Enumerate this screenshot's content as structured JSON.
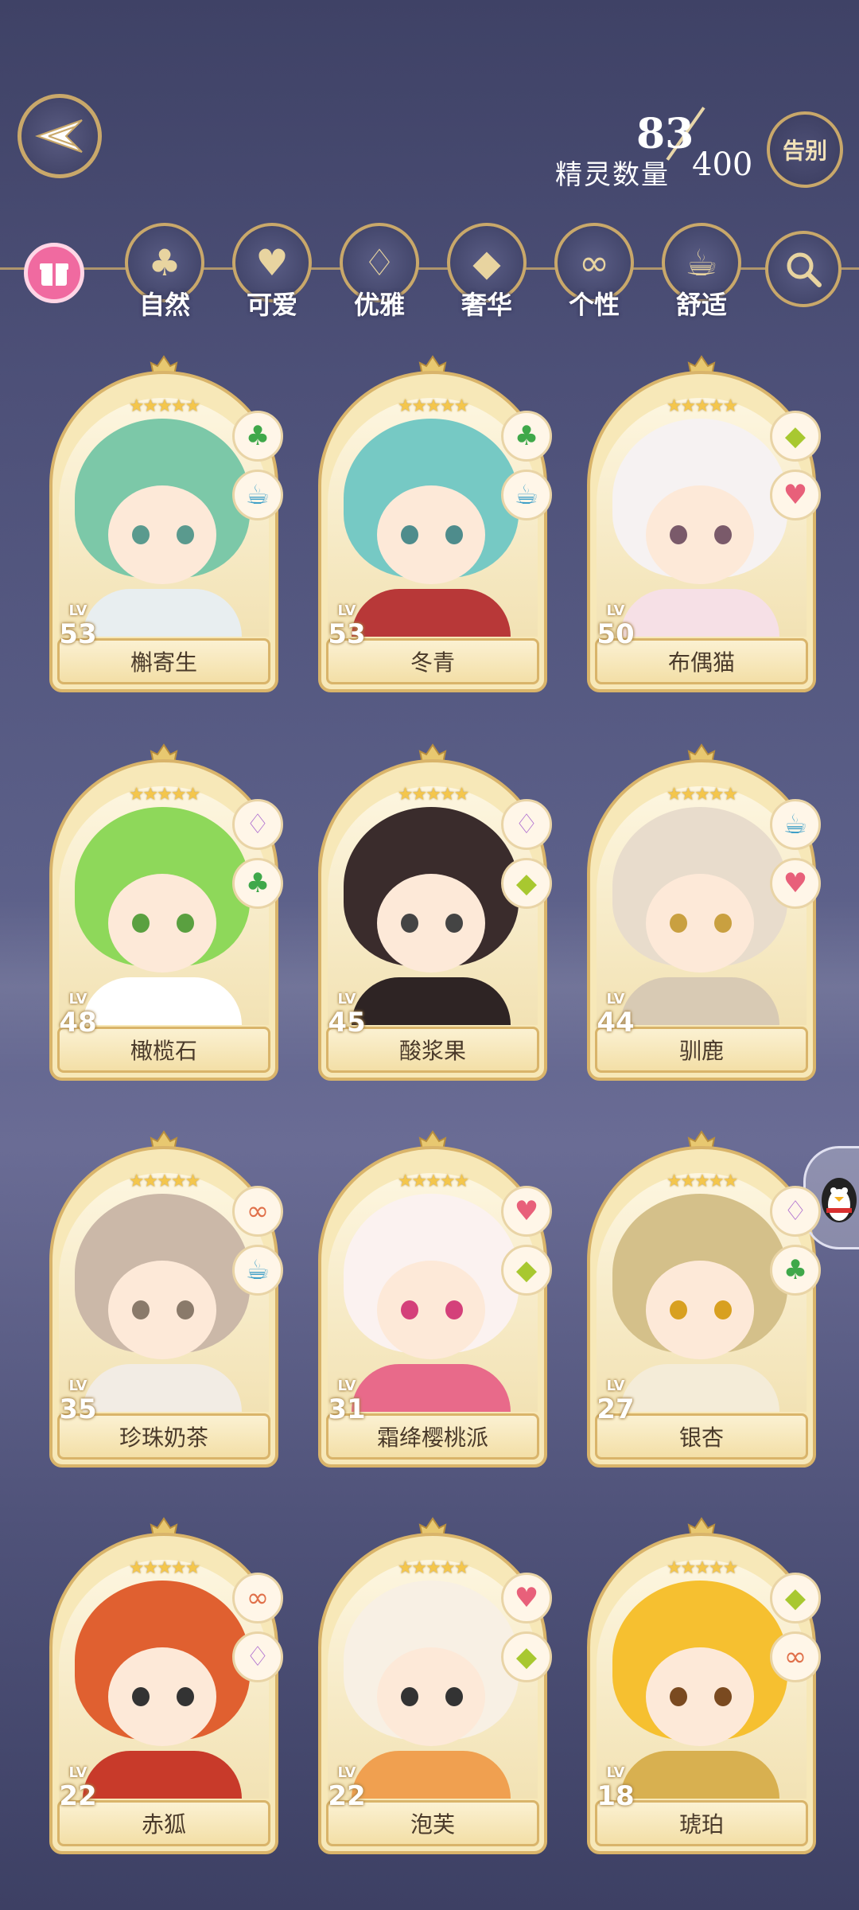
{
  "header": {
    "spirit_count": "83",
    "spirit_label": "精灵数量",
    "spirit_max": "400",
    "farewell_label": "告别"
  },
  "filters": [
    {
      "label": "自然",
      "icon": "clover-icon",
      "glyph": "♣"
    },
    {
      "label": "可爱",
      "icon": "heart-icon",
      "glyph": "♥"
    },
    {
      "label": "优雅",
      "icon": "swan-icon",
      "glyph": "♢"
    },
    {
      "label": "奢华",
      "icon": "diamond-icon",
      "glyph": "◆"
    },
    {
      "label": "个性",
      "icon": "glasses-icon",
      "glyph": "∞"
    },
    {
      "label": "舒适",
      "icon": "teacup-icon",
      "glyph": "☕"
    }
  ],
  "cards": [
    {
      "name": "槲寄生",
      "level": "53",
      "stars": "★★★★★",
      "tags": [
        "clover-icon",
        "teacup-icon"
      ],
      "hair": "#7cc8a8",
      "body": "#e8eef0",
      "eye": "#5a9a8e"
    },
    {
      "name": "冬青",
      "level": "53",
      "stars": "★★★★★",
      "tags": [
        "clover-icon",
        "teacup-icon"
      ],
      "hair": "#76c9c4",
      "body": "#b83838",
      "eye": "#4e8c8c"
    },
    {
      "name": "布偶猫",
      "level": "50",
      "stars": "★★★★★",
      "tags": [
        "diamond-icon",
        "heart-icon"
      ],
      "hair": "#f6f2f2",
      "body": "#f6e0e6",
      "eye": "#7a5a6a"
    },
    {
      "name": "橄榄石",
      "level": "48",
      "stars": "★★★★★",
      "tags": [
        "swan-icon",
        "clover-icon"
      ],
      "hair": "#8ed85a",
      "body": "#ffffff",
      "eye": "#5aa040"
    },
    {
      "name": "酸浆果",
      "level": "45",
      "stars": "★★★★★",
      "tags": [
        "swan-icon",
        "diamond-icon"
      ],
      "hair": "#3a2c2c",
      "body": "#2e2424",
      "eye": "#444444"
    },
    {
      "name": "驯鹿",
      "level": "44",
      "stars": "★★★★★",
      "tags": [
        "teacup-icon",
        "heart-icon"
      ],
      "hair": "#e8dccc",
      "body": "#d8cab4",
      "eye": "#c9a040"
    },
    {
      "name": "珍珠奶茶",
      "level": "35",
      "stars": "★★★★★",
      "tags": [
        "glasses-icon",
        "teacup-icon"
      ],
      "hair": "#cbb8a8",
      "body": "#f2ece4",
      "eye": "#8a7a6a"
    },
    {
      "name": "霜绛樱桃派",
      "level": "31",
      "stars": "★★★★★",
      "tags": [
        "heart-icon",
        "diamond-icon"
      ],
      "hair": "#fbf2f0",
      "body": "#e86a8a",
      "eye": "#d4407a"
    },
    {
      "name": "银杏",
      "level": "27",
      "stars": "★★★★★",
      "tags": [
        "swan-icon",
        "clover-icon"
      ],
      "hair": "#d4c08a",
      "body": "#f4ecd8",
      "eye": "#d8a020"
    },
    {
      "name": "赤狐",
      "level": "22",
      "stars": "★★★★★",
      "tags": [
        "glasses-icon",
        "swan-icon"
      ],
      "hair": "#e06030",
      "body": "#c83a2a",
      "eye": "#333333"
    },
    {
      "name": "泡芙",
      "level": "22",
      "stars": "★★★★★",
      "tags": [
        "heart-icon",
        "diamond-icon"
      ],
      "hair": "#f8f0e4",
      "body": "#f0a050",
      "eye": "#333333"
    },
    {
      "name": "琥珀",
      "level": "18",
      "stars": "★★★★★",
      "tags": [
        "diamond-icon",
        "glasses-icon"
      ],
      "hair": "#f6c030",
      "body": "#d8b050",
      "eye": "#7a4a20"
    }
  ],
  "card_level_prefix": "LV"
}
